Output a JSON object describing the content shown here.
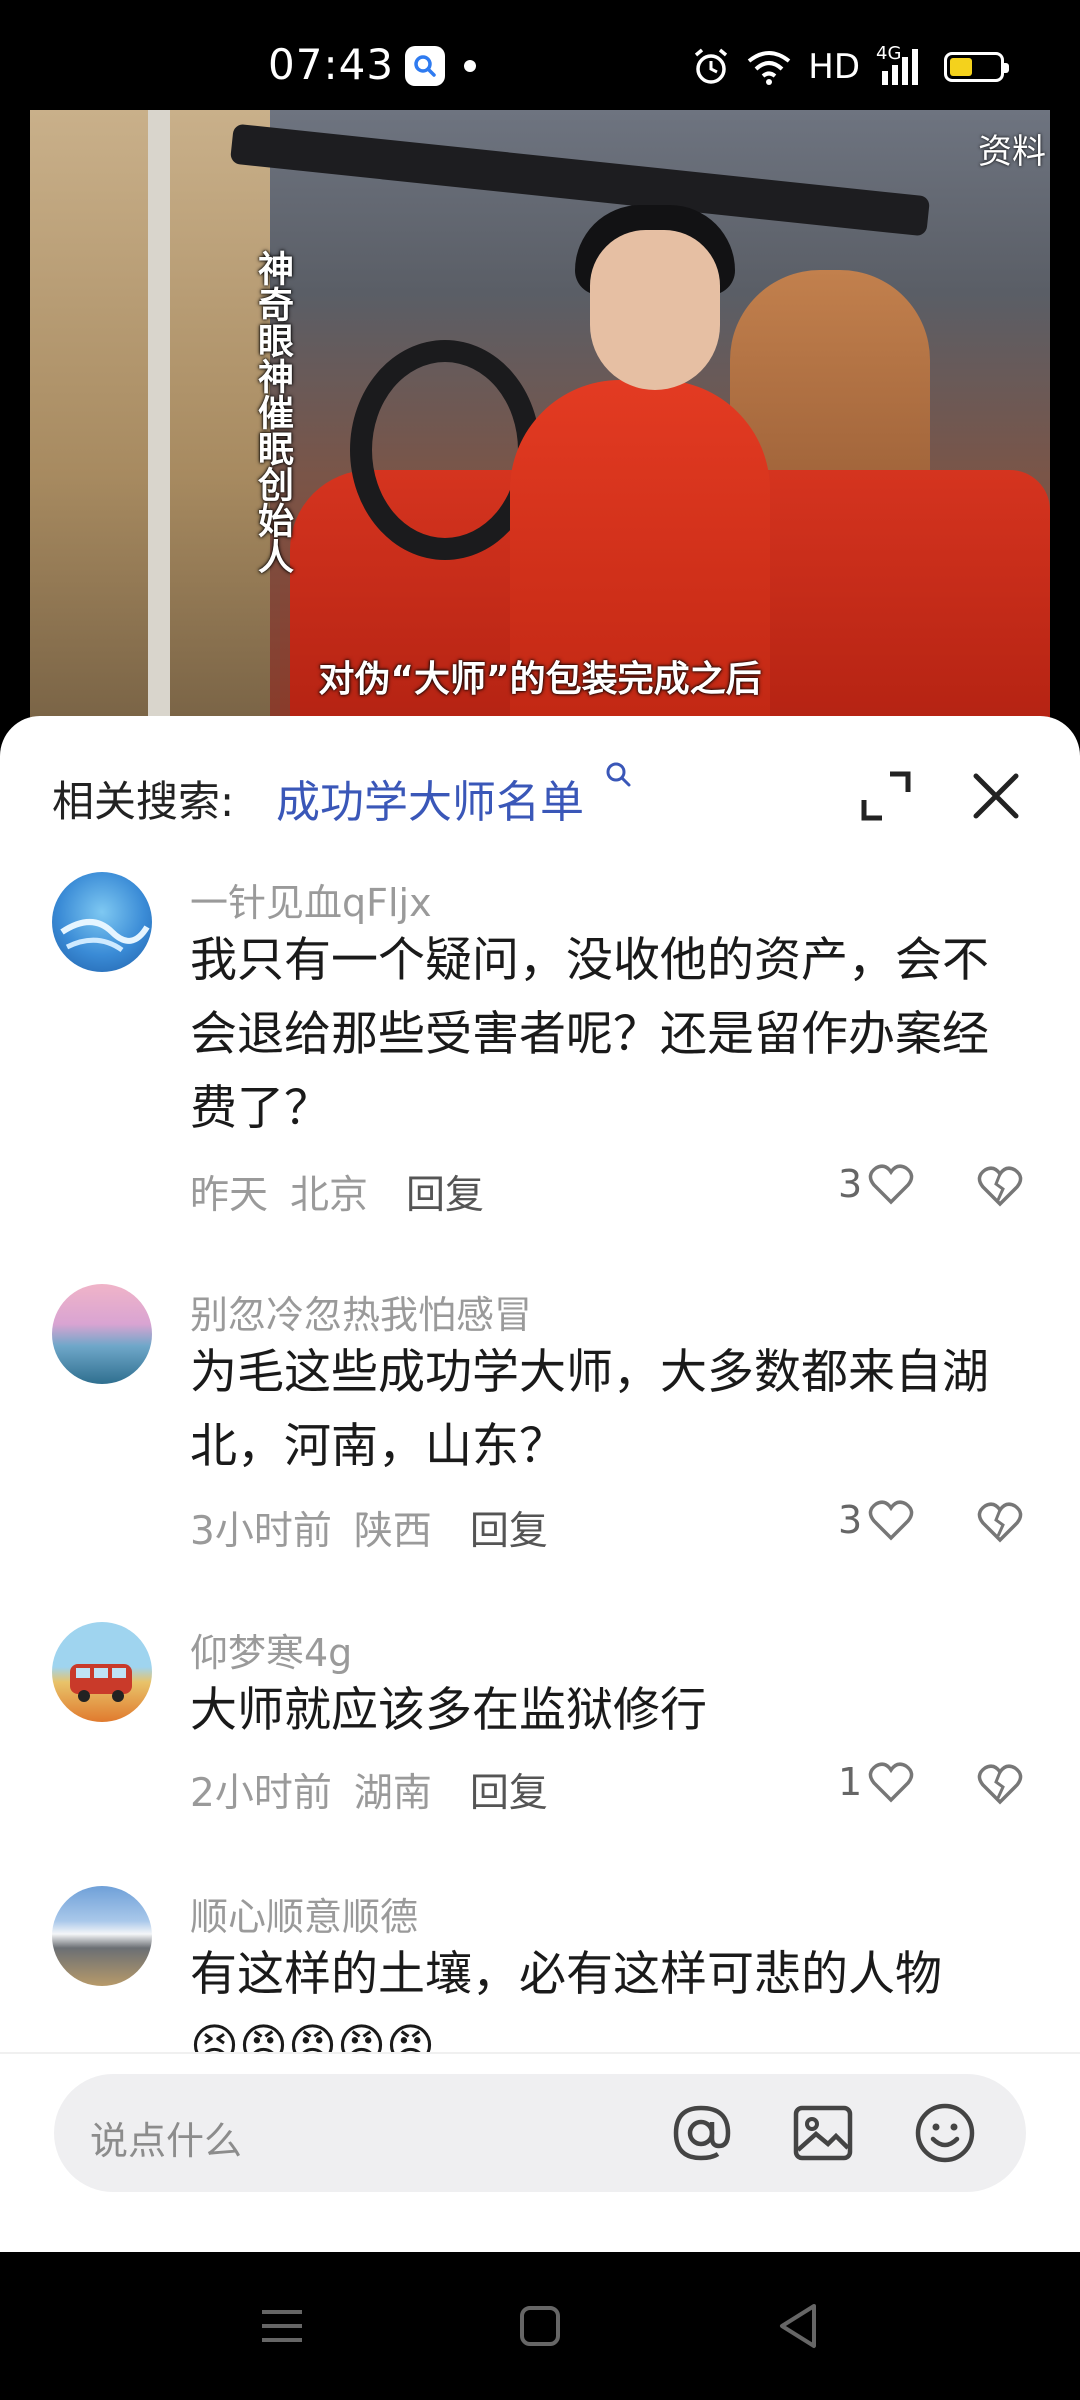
{
  "status_bar": {
    "time": "07:43",
    "network": "HD",
    "signal_label": "4G",
    "battery_level": 0.45
  },
  "video": {
    "vertical_caption": "神奇眼神催眠创始人",
    "corner_tag": "资料",
    "subtitle": "对伪“大师”的包装完成之后"
  },
  "sheet": {
    "related_label": "相关搜索:",
    "related_link": "成功学大师名单"
  },
  "comments": [
    {
      "username": "一针见血qFljx",
      "text": "我只有一个疑问，没收他的资产，会不会退给那些受害者呢？还是留作办案经费了？",
      "time": "昨天",
      "location": "北京",
      "reply": "回复",
      "likes": "3"
    },
    {
      "username": "别忽冷忽热我怕感冒",
      "text": "为毛这些成功学大师，大多数都来自湖北，河南，山东？",
      "time": "3小时前",
      "location": "陕西",
      "reply": "回复",
      "likes": "3"
    },
    {
      "username": "仰梦寒4g",
      "text": "大师就应该多在监狱修行",
      "time": "2小时前",
      "location": "湖南",
      "reply": "回复",
      "likes": "1"
    },
    {
      "username": "顺心顺意顺德",
      "text": "有这样的土壤，必有这样可悲的人物",
      "emojis": "😣😡😡😡😡"
    }
  ],
  "input": {
    "placeholder": "说点什么"
  },
  "colors": {
    "link": "#3a57b8",
    "meta": "#9a9a9a",
    "battery": "#f4d21c"
  },
  "icons": [
    "search-icon",
    "alarm-icon",
    "wifi-icon",
    "signal-icon",
    "battery-icon",
    "expand-icon",
    "close-icon",
    "heart-icon",
    "broken-heart-icon",
    "at-icon",
    "image-icon",
    "emoji-icon",
    "menu-icon",
    "home-icon",
    "back-icon"
  ]
}
